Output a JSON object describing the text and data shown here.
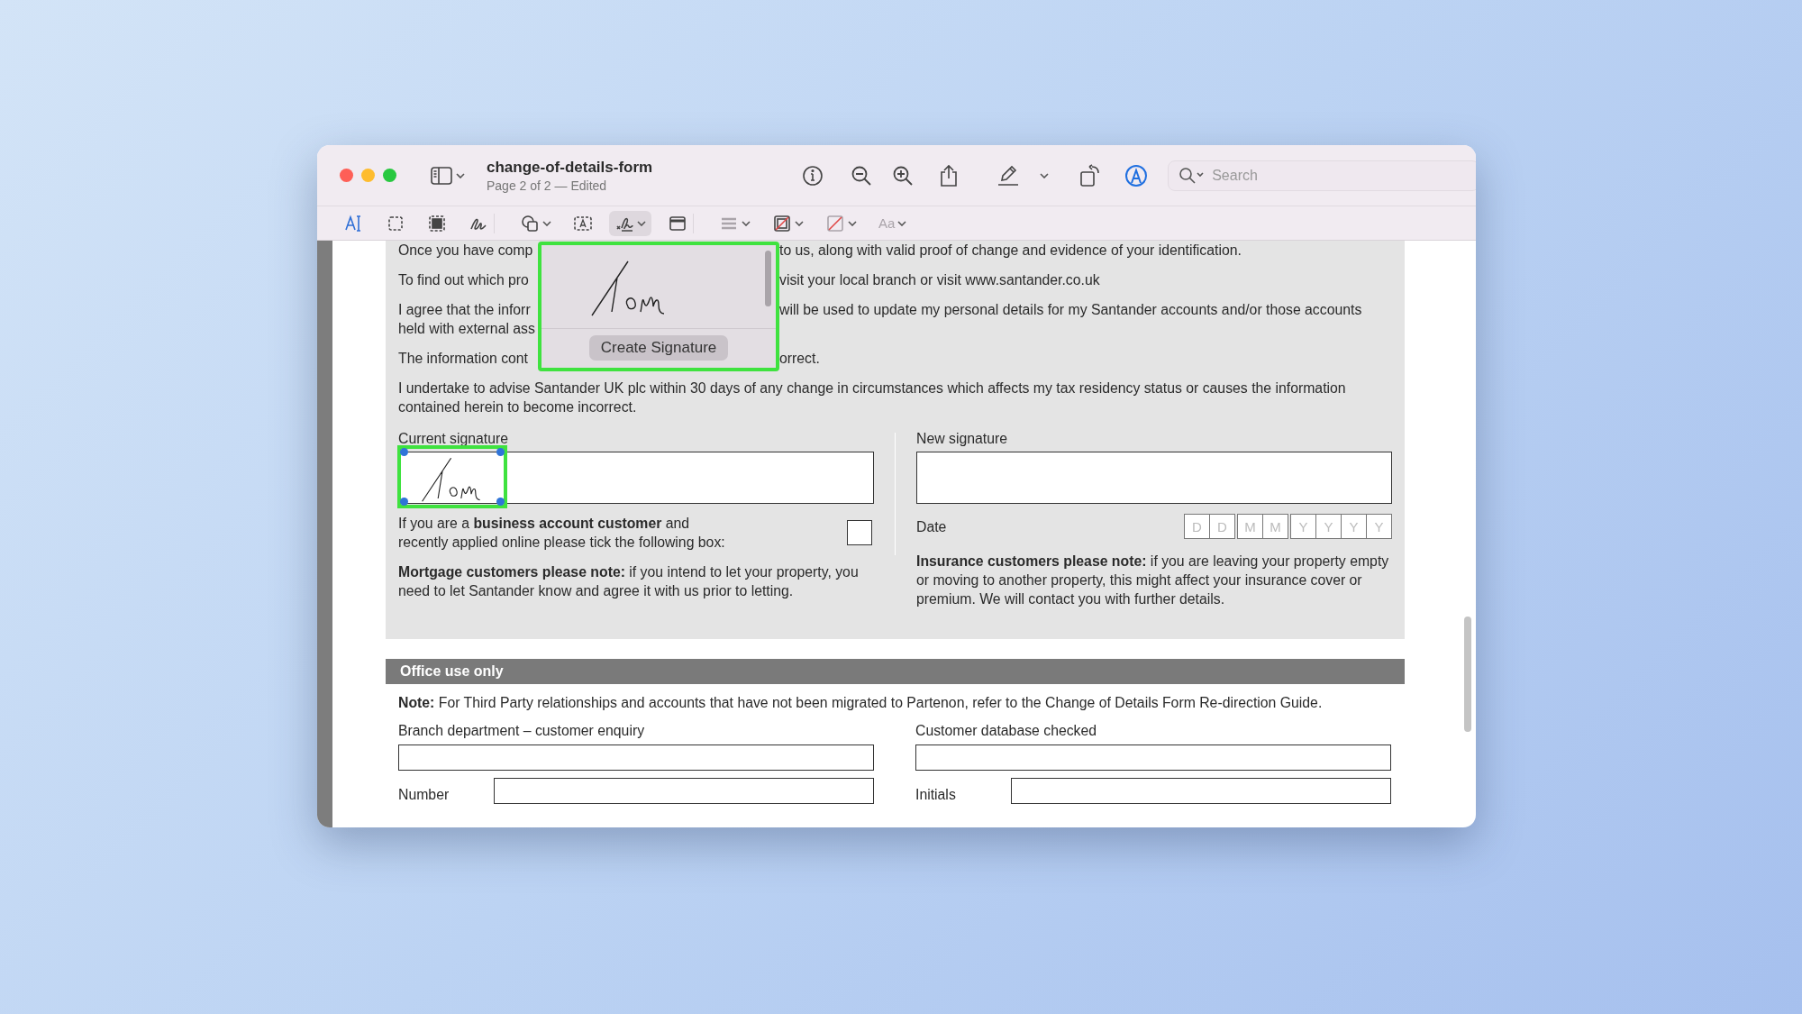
{
  "window": {
    "title": "change-of-details-form",
    "subtitle": "Page 2 of 2 — Edited"
  },
  "toolbar": {
    "markup_active": true,
    "search": {
      "placeholder": "Search"
    }
  },
  "tools": [
    {
      "kind": "text-select",
      "selected": false,
      "disabled": false,
      "menu": false
    },
    {
      "kind": "rect-select",
      "selected": false,
      "disabled": false,
      "menu": false
    },
    {
      "kind": "smart-lasso",
      "selected": false,
      "disabled": false,
      "menu": false
    },
    {
      "kind": "sketch",
      "selected": false,
      "disabled": false,
      "menu": false
    },
    {
      "kind": "shapes",
      "selected": false,
      "disabled": false,
      "menu": true
    },
    {
      "kind": "text-box",
      "selected": false,
      "disabled": false,
      "menu": false
    },
    {
      "kind": "sign",
      "selected": true,
      "disabled": false,
      "menu": true
    },
    {
      "kind": "note",
      "selected": false,
      "disabled": false,
      "menu": false
    },
    {
      "kind": "shape-style",
      "selected": false,
      "disabled": true,
      "menu": true
    },
    {
      "kind": "border-color",
      "selected": false,
      "disabled": false,
      "menu": true
    },
    {
      "kind": "fill-color",
      "selected": false,
      "disabled": true,
      "menu": true
    },
    {
      "kind": "text-style",
      "label": "Aa",
      "selected": false,
      "disabled": true,
      "menu": true
    }
  ],
  "signature_popover": {
    "button": "Create Signature"
  },
  "intro": [
    {
      "left": [
        "Once you have comp"
      ],
      "right": "to us, along with valid proof of change and evidence of your identification."
    },
    {
      "left": [
        "To find out which pro"
      ],
      "right": "visit your local branch or visit www.santander.co.uk"
    },
    {
      "left": [
        "I agree that the inforr",
        "held with external ass"
      ],
      "right": "will be used to update my personal details for my Santander accounts and/or those accounts"
    },
    {
      "left": [
        "The information cont"
      ],
      "right": "orrect."
    }
  ],
  "undertaking": "I undertake to advise Santander UK plc within 30 days of any change in circumstances which affects my tax residency status or causes the information contained herein to become incorrect.",
  "current_signature": {
    "label": "Current signature",
    "signed": true
  },
  "business_note": {
    "text": "If you are a **business account customer** and recently applied online please tick the following box:",
    "checked": false
  },
  "mortgage_note": "**Mortgage customers please note:** if you intend to let your property, you need to let Santander know and agree it with us prior to letting.",
  "new_signature": {
    "label": "New signature"
  },
  "date": {
    "label": "Date",
    "boxes": [
      "D",
      "D",
      "M",
      "M",
      "Y",
      "Y",
      "Y",
      "Y"
    ]
  },
  "insurance_note": "**Insurance customers please note:** if you are leaving your property empty or moving to another property, this might affect your insurance cover or premium. We will contact you with further details.",
  "office": {
    "heading": "Office use only",
    "note": "**Note:** For Third Party relationships and accounts that have not been migrated to Partenon, refer to the Change of Details Form Re-direction Guide.",
    "fields": [
      {
        "label": "Branch department – customer enquiry"
      },
      {
        "label": "Customer database checked"
      },
      {
        "label": "Number"
      },
      {
        "label": "Initials"
      }
    ]
  }
}
